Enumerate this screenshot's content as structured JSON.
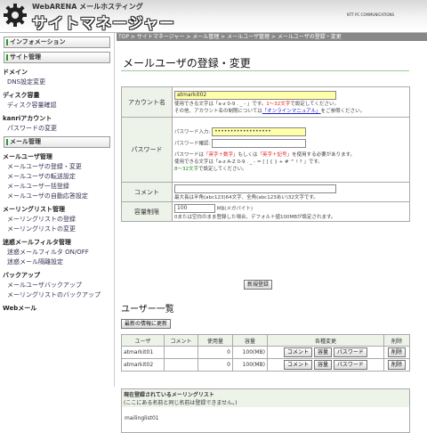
{
  "header": {
    "brand_small": "WebARENA メールホスティング",
    "brand_main": "サイトマネージャー",
    "ntt": "NTT PC COMMUNICATIONS"
  },
  "breadcrumb": "TOP > サイトマネージャー > メール管理 > メールユーザ管理 > メールユーザの登録・変更",
  "sidebar": {
    "buttons": [
      "インフォメーション",
      "サイト管理"
    ],
    "sections": [
      {
        "title": "ドメイン",
        "items": [
          "DNS設定変更"
        ]
      },
      {
        "title": "ディスク容量",
        "items": [
          "ディスク容量確認"
        ]
      },
      {
        "title": "kanriアカウント",
        "items": [
          "パスワードの変更"
        ]
      }
    ],
    "mail_button": "メール管理",
    "mail_sections": [
      {
        "title": "メールユーザ管理",
        "items": [
          "メールユーザの登録・変更",
          "メールユーザの転送設定",
          "メールユーザ一括登録",
          "メールユーザの自動応答設定"
        ]
      },
      {
        "title": "メーリングリスト管理",
        "items": [
          "メーリングリストの登録",
          "メーリングリストの変更"
        ]
      },
      {
        "title": "迷惑メールフィルタ管理",
        "items": [
          "迷惑メールフィルタ ON/OFF",
          "迷惑メール隔離設定"
        ]
      },
      {
        "title": "バックアップ",
        "items": [
          "メールユーザバックアップ",
          "メーリングリストのバックアップ"
        ]
      },
      {
        "title": "Webメール",
        "items": []
      }
    ]
  },
  "main": {
    "title": "メールユーザの登録・変更",
    "account_label": "アカウント名",
    "account_value": "atmarkit02",
    "account_hint1_pre": "使用できる文字は「a-z 0-9 . _ - 」です。",
    "account_hint1_red": "1〜32文字",
    "account_hint1_post": "で設定してください。",
    "account_hint2_pre": "その他、アカウント名の制限については",
    "account_hint2_link": "「オンラインマニュアル」",
    "account_hint2_post": "をご参照ください。",
    "password_label": "パスワード",
    "pw_input_label": "パスワード入力:",
    "pw_input_value": "••••••••••••••••••",
    "pw_confirm_label": "パスワード確認:",
    "pw_hint1_pre": "パスワードは",
    "pw_hint1_red": "「英字＋数字」",
    "pw_hint1_mid": "もしくは",
    "pw_hint1_red2": "「英字＋記号」",
    "pw_hint1_post": "を使用する必要があります。",
    "pw_hint2": "使用できる文字は「a-z A-Z 0-9 . _ - = [ ] { } + # ^ ! ? 」です。",
    "pw_hint3_green": "8〜32文字",
    "pw_hint3_post": "で設定してください。",
    "comment_label": "コメント",
    "comment_hint": "最大長は半角(abc123)64文字、全角(abc123あい)32文字です。",
    "quota_label": "容量制限",
    "quota_value": "100",
    "quota_unit": "MB(メガバイト)",
    "quota_hint": "0または空白のまま登録した場合、デフォルト値100MBが設定されます。",
    "register_button": "新規登録",
    "users_title": "ユーザー一覧",
    "update_button": "最新の情報に更新",
    "columns": [
      "ユーザ",
      "コメント",
      "使用量",
      "容量",
      "各種変更",
      "削除"
    ],
    "rows": [
      {
        "user": "atmarkit01",
        "comment": "",
        "usage": "0",
        "quota": "100(MB)",
        "btn1": "コメント",
        "btn2": "容量",
        "btn3": "パスワード",
        "del": "削除"
      },
      {
        "user": "atmarkit02",
        "comment": "",
        "usage": "0",
        "quota": "100(MB)",
        "btn1": "コメント",
        "btn2": "容量",
        "btn3": "パスワード",
        "del": "削除"
      }
    ],
    "ml_title": "現在登録されているメーリングリスト",
    "ml_note": "(ここにある名前と同じ名前は登録できません。)",
    "ml_item": "mailinglist01"
  },
  "colors": {
    "accent_green": "#2a9a2a",
    "label_bg": "#eef3ea",
    "breadcrumb_bg": "#888888",
    "highlight_input": "#ffffaa"
  }
}
